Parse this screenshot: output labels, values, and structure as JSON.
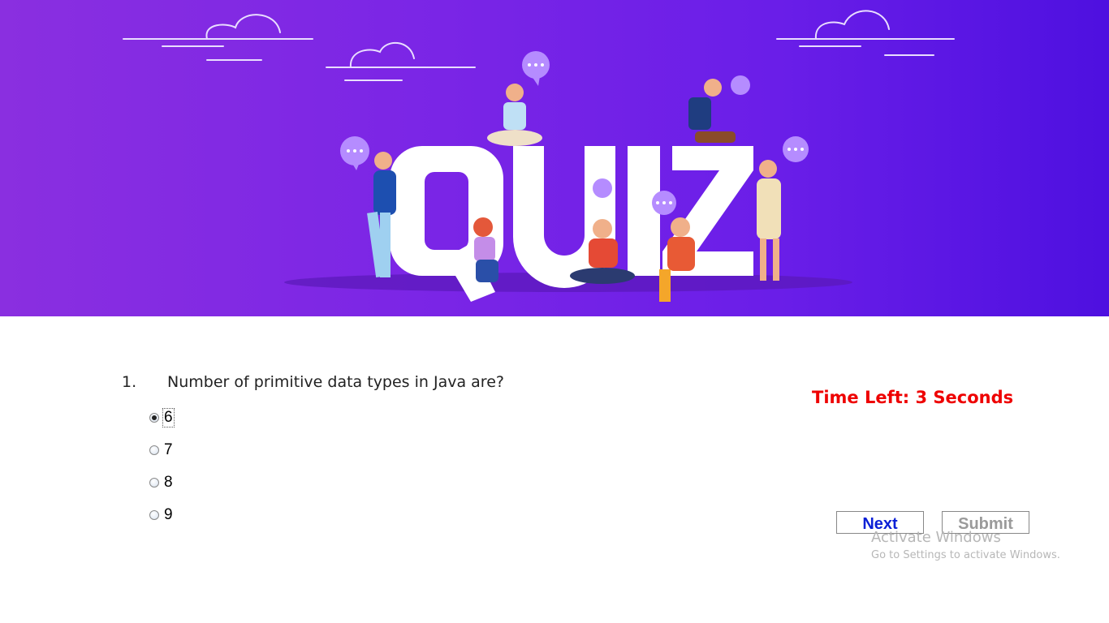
{
  "banner": {
    "title": "QUIZ",
    "colors": {
      "gradient_start": "#8a2fe0",
      "gradient_end": "#4e10e0"
    }
  },
  "question": {
    "number": "1.",
    "text": "Number of primitive data types in Java are?",
    "options": [
      {
        "label": "6",
        "selected": true
      },
      {
        "label": "7",
        "selected": false
      },
      {
        "label": "8",
        "selected": false
      },
      {
        "label": "9",
        "selected": false
      }
    ]
  },
  "timer": {
    "text": "Time Left: 3 Seconds",
    "color": "#ee0000"
  },
  "buttons": {
    "next_label": "Next",
    "submit_label": "Submit"
  },
  "watermark": {
    "title": "Activate Windows",
    "subtitle": "Go to Settings to activate Windows."
  }
}
